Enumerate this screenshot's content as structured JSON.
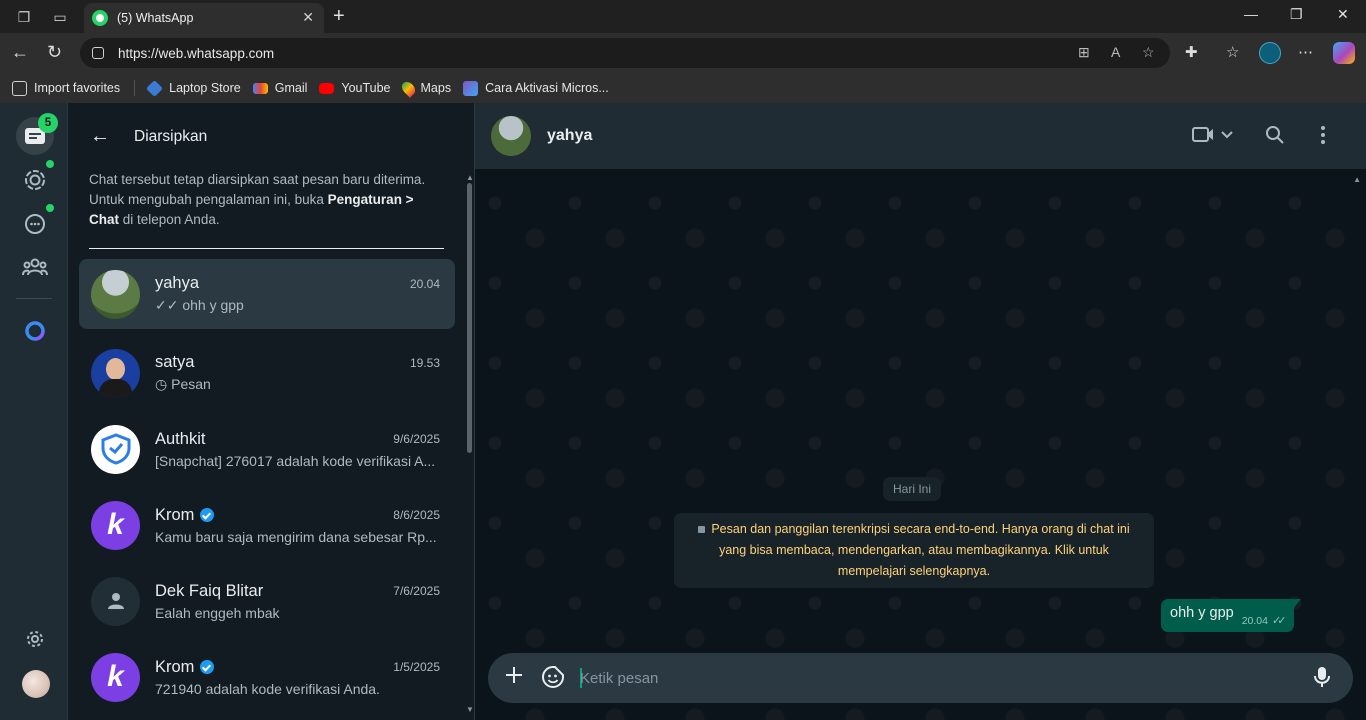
{
  "browser": {
    "tab_title": "(5) WhatsApp",
    "url": "https://web.whatsapp.com",
    "bookmarks": [
      {
        "label": "Import favorites",
        "icon": "import-icon"
      },
      {
        "label": "Laptop Store",
        "icon": "laptop-store-icon"
      },
      {
        "label": "Gmail",
        "icon": "gmail-icon"
      },
      {
        "label": "YouTube",
        "icon": "youtube-icon"
      },
      {
        "label": "Maps",
        "icon": "maps-icon"
      },
      {
        "label": "Cara Aktivasi Micros...",
        "icon": "cara-aktivasi-icon"
      }
    ]
  },
  "rail": {
    "chats_badge": "5"
  },
  "sidebar": {
    "title": "Diarsipkan",
    "note_part1": "Chat tersebut tetap diarsipkan saat pesan baru diterima. Untuk mengubah pengalaman ini, buka ",
    "note_bold1": "Pengaturan >",
    "note_bold2": "Chat",
    "note_part2": " di telepon Anda.",
    "chats": [
      {
        "name": "yahya",
        "time": "20.04",
        "preview": "✓✓ ohh y gpp",
        "selected": true
      },
      {
        "name": "satya",
        "time": "19.53",
        "preview": "◷ Pesan"
      },
      {
        "name": "Authkit",
        "time": "9/6/2025",
        "preview": "[Snapchat] 276017 adalah kode verifikasi A..."
      },
      {
        "name": "Krom",
        "time": "8/6/2025",
        "preview": "Kamu baru saja mengirim dana sebesar Rp...",
        "verified": true
      },
      {
        "name": "Dek Faiq Blitar",
        "time": "7/6/2025",
        "preview": "Ealah enggeh mbak"
      },
      {
        "name": "Krom",
        "time": "1/5/2025",
        "preview": "721940 adalah kode verifikasi Anda.",
        "verified": true
      }
    ]
  },
  "conversation": {
    "contact_name": "yahya",
    "day_label": "Hari Ini",
    "encryption_notice": "Pesan dan panggilan terenkripsi secara end-to-end. Hanya orang di chat ini yang bisa membaca, mendengarkan, atau membagikannya. Klik untuk mempelajari selengkapnya.",
    "message": {
      "text": "ohh y gpp",
      "time": "20.04",
      "status": "read"
    },
    "composer_placeholder": "Ketik pesan"
  },
  "colors": {
    "accent": "#25d366",
    "outgoing_bubble": "#005c4b",
    "notice_text": "#ffd279"
  }
}
